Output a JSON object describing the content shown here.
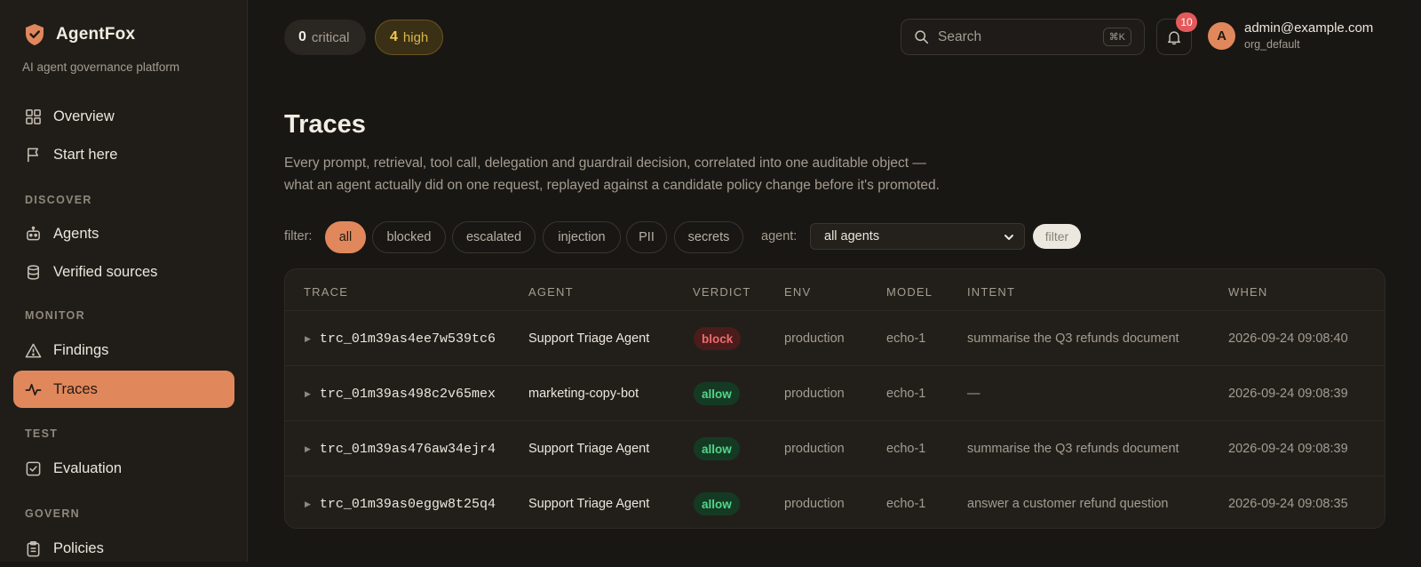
{
  "brand": {
    "name": "AgentFox",
    "tagline": "AI agent governance platform",
    "accent": "#e0885c"
  },
  "sidebar": {
    "items_top": [
      {
        "label": "Overview",
        "icon": "grid-icon"
      },
      {
        "label": "Start here",
        "icon": "flag-icon"
      }
    ],
    "sections": [
      {
        "title": "DISCOVER",
        "items": [
          {
            "label": "Agents",
            "icon": "robot-icon"
          },
          {
            "label": "Verified sources",
            "icon": "database-icon"
          }
        ]
      },
      {
        "title": "MONITOR",
        "items": [
          {
            "label": "Findings",
            "icon": "warning-icon"
          },
          {
            "label": "Traces",
            "icon": "activity-icon",
            "active": true
          }
        ]
      },
      {
        "title": "TEST",
        "items": [
          {
            "label": "Evaluation",
            "icon": "checkbox-icon"
          }
        ]
      },
      {
        "title": "GOVERN",
        "items": [
          {
            "label": "Policies",
            "icon": "clipboard-icon"
          }
        ]
      }
    ]
  },
  "topbar": {
    "critical": {
      "count": "0",
      "label": "critical"
    },
    "high": {
      "count": "4",
      "label": "high"
    },
    "search": {
      "placeholder": "Search",
      "shortcut": "⌘K"
    },
    "notifications": {
      "count": "10"
    },
    "user": {
      "initial": "A",
      "email": "admin@example.com",
      "org": "org_default"
    }
  },
  "page": {
    "title": "Traces",
    "description_line1": "Every prompt, retrieval, tool call, delegation and guardrail decision, correlated into one auditable object —",
    "description_line2": "what an agent actually did on one request, replayed against a candidate policy change before it's promoted."
  },
  "filters": {
    "label": "filter:",
    "chips": [
      "all",
      "blocked",
      "escalated",
      "injection",
      "PII",
      "secrets"
    ],
    "active": "all",
    "agent_label": "agent:",
    "agent_value": "all agents",
    "button": "filter"
  },
  "table": {
    "headers": [
      "TRACE",
      "AGENT",
      "VERDICT",
      "ENV",
      "MODEL",
      "INTENT",
      "WHEN"
    ],
    "rows": [
      {
        "trace": "trc_01m39as4ee7w539tc6",
        "agent": "Support Triage Agent",
        "verdict": "block",
        "env": "production",
        "model": "echo-1",
        "intent": "summarise the Q3 refunds document",
        "when": "2026-09-24 09:08:40"
      },
      {
        "trace": "trc_01m39as498c2v65mex",
        "agent": "marketing-copy-bot",
        "verdict": "allow",
        "env": "production",
        "model": "echo-1",
        "intent": "—",
        "when": "2026-09-24 09:08:39"
      },
      {
        "trace": "trc_01m39as476aw34ejr4",
        "agent": "Support Triage Agent",
        "verdict": "allow",
        "env": "production",
        "model": "echo-1",
        "intent": "summarise the Q3 refunds document",
        "when": "2026-09-24 09:08:39"
      },
      {
        "trace": "trc_01m39as0eggw8t25q4",
        "agent": "Support Triage Agent",
        "verdict": "allow",
        "env": "production",
        "model": "echo-1",
        "intent": "answer a customer refund question",
        "when": "2026-09-24 09:08:35"
      }
    ]
  }
}
